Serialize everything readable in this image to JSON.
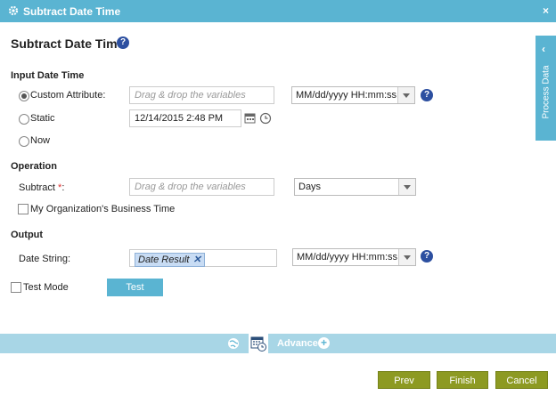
{
  "window": {
    "title": "Subtract Date Time",
    "close_glyph": "×"
  },
  "page": {
    "heading": "Subtract Date Time",
    "help_glyph": "?"
  },
  "input_date_time": {
    "section_label": "Input Date Time",
    "options": [
      {
        "label": "Custom Attribute:",
        "selected": true
      },
      {
        "label": "Static",
        "selected": false
      },
      {
        "label": "Now",
        "selected": false
      }
    ],
    "custom_attribute_placeholder": "Drag & drop the variables",
    "format_value": "MM/dd/yyyy HH:mm:ss",
    "static_value": "12/14/2015 2:48 PM"
  },
  "operation": {
    "section_label": "Operation",
    "subtract_label": "Subtract",
    "required_mark": "*",
    "subtract_suffix": ":",
    "subtract_placeholder": "Drag & drop the variables",
    "unit_value": "Days",
    "business_time_label": "My Organization's Business Time"
  },
  "output": {
    "section_label": "Output",
    "date_string_label": "Date String:",
    "date_string_tag": "Date Result",
    "tag_remove_glyph": "✕",
    "format_value": "MM/dd/yyyy HH:mm:ss"
  },
  "test": {
    "mode_label": "Test Mode",
    "button_label": "Test"
  },
  "side_panel": {
    "label": "Process Data",
    "chevron": "‹"
  },
  "advanced": {
    "label": "Advanced",
    "plus_glyph": "+"
  },
  "footer": {
    "prev": "Prev",
    "finish": "Finish",
    "cancel": "Cancel"
  },
  "colors": {
    "accent": "#5ab4d2",
    "button": "#8d9a22",
    "help": "#2c4fa0",
    "required": "#e03030"
  }
}
